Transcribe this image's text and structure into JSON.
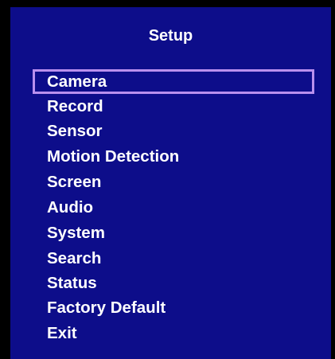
{
  "menu": {
    "title": "Setup",
    "selected_index": 0,
    "highlight_color": "#b990ee",
    "background_color": "#0d0d8a",
    "items": [
      {
        "label": "Camera"
      },
      {
        "label": "Record"
      },
      {
        "label": "Sensor"
      },
      {
        "label": "Motion Detection"
      },
      {
        "label": "Screen"
      },
      {
        "label": "Audio"
      },
      {
        "label": "System"
      },
      {
        "label": "Search"
      },
      {
        "label": "Status"
      },
      {
        "label": "Factory Default"
      },
      {
        "label": "Exit"
      }
    ]
  }
}
